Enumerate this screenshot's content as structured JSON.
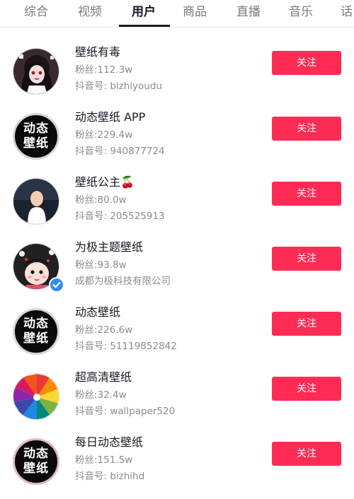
{
  "tabs": [
    {
      "label": "综合"
    },
    {
      "label": "视频"
    },
    {
      "label": "用户"
    },
    {
      "label": "商品"
    },
    {
      "label": "直播"
    },
    {
      "label": "音乐"
    },
    {
      "label": "话"
    }
  ],
  "active_tab_index": 2,
  "colors": {
    "follow_bg": "#fe2c55",
    "verified": "#2f8cf5"
  },
  "users": [
    {
      "name": "壁纸有毒",
      "fans": "粉丝:112.3w",
      "detail": "抖音号: bizhiyoudu",
      "follow": "关注",
      "avatar": "anime-girl-avatar"
    },
    {
      "name": "动态壁纸 APP",
      "fans": "粉丝:229.4w",
      "detail": "抖音号: 940877724",
      "follow": "关注",
      "avatar": "text-logo-avatar",
      "avatar_text": [
        "动态",
        "壁纸"
      ]
    },
    {
      "name": "壁纸公主🍒",
      "fans": "粉丝:80.0w",
      "detail": "抖音号: 205525913",
      "follow": "关注",
      "avatar": "portrait-avatar"
    },
    {
      "name": "为极主题壁纸",
      "fans": "粉丝:93.8w",
      "detail": "成都为极科技有限公司",
      "follow": "关注",
      "avatar": "cartoon-avatar",
      "verified": true
    },
    {
      "name": "动态壁纸",
      "fans": "粉丝:226.6w",
      "detail": "抖音号: 51119852842",
      "follow": "关注",
      "avatar": "text-logo-avatar",
      "avatar_text": [
        "动态",
        "壁纸"
      ]
    },
    {
      "name": "超高清壁纸",
      "fans": "粉丝:32.4w",
      "detail": "抖音号: wallpaper520",
      "follow": "关注",
      "avatar": "rainbow-spiral-avatar"
    },
    {
      "name": "每日动态壁纸",
      "fans": "粉丝:151.5w",
      "detail": "抖音号: bizhihd",
      "follow": "关注",
      "avatar": "text-logo-avatar",
      "avatar_text": [
        "动态",
        "壁纸"
      ]
    }
  ]
}
